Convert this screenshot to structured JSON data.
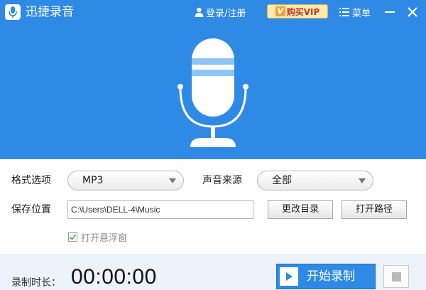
{
  "window": {
    "title": "迅捷录音",
    "login_label": "登录/注册",
    "vip_label": "购买VIP",
    "vip_badge": "V",
    "menu_label": "菜单"
  },
  "form": {
    "format_label": "格式选项",
    "format_value": "MP3",
    "source_label": "声音来源",
    "source_value": "全部",
    "save_label": "保存位置",
    "save_path": "C:\\Users\\DELL-4\\Music",
    "change_dir_button": "更改目录",
    "open_path_button": "打开路径",
    "float_window_label": "打开悬浮窗",
    "float_window_checked": true
  },
  "bottom": {
    "duration_label": "录制时长：",
    "timer": "00:00:00",
    "start_button": "开始录制"
  },
  "colors": {
    "primary": "#2f8ae5",
    "vip_bg": "#fdebb0",
    "vip_text": "#c0392b",
    "bottom_bg": "#ecf3fa",
    "mic_accent": "#8fc5f5"
  }
}
